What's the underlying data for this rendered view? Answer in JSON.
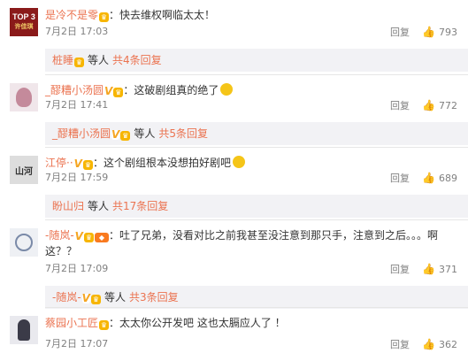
{
  "comments": [
    {
      "username": "是冷不是零",
      "text": "：快去维权啊临太太！",
      "date": "7月2日 17:03",
      "reply": "回复",
      "likes": "793",
      "avatar_text": "TOP 3\n许佳琪",
      "sub": {
        "name": "桩睡",
        "mid": "等人",
        "link": "共4条回复"
      }
    },
    {
      "username": "_醪糟小汤圆",
      "text": "：这破剧组真的绝了",
      "date": "7月2日 17:41",
      "reply": "回复",
      "likes": "772",
      "sub": {
        "name": "_醪糟小汤圆",
        "mid": "等人",
        "link": "共5条回复"
      }
    },
    {
      "username": "江停··",
      "text": "：这个剧组根本没想拍好剧吧",
      "date": "7月2日 17:59",
      "reply": "回复",
      "likes": "689",
      "sub": {
        "name": "盼山归",
        "mid": "等人",
        "link": "共17条回复"
      }
    },
    {
      "username": "-随岚-",
      "text1": "：吐了兄弟，没看对比之前我甚至没注意到那只手，注意到之后。。。啊",
      "text2": "这？？",
      "date": "7月2日 17:09",
      "reply": "回复",
      "likes": "371",
      "sub": {
        "name": "-随岚-",
        "mid": "等人",
        "link": "共3条回复"
      }
    },
    {
      "username": "蔡园小工匠",
      "text": "：太太你公开发吧    这也太膈应人了  ！",
      "date": "7月2日 17:07",
      "reply": "回复",
      "likes": "362"
    }
  ],
  "colors": {
    "username": "#eb7350",
    "meta": "#808080",
    "subbox_bg": "#f2f2f5"
  }
}
